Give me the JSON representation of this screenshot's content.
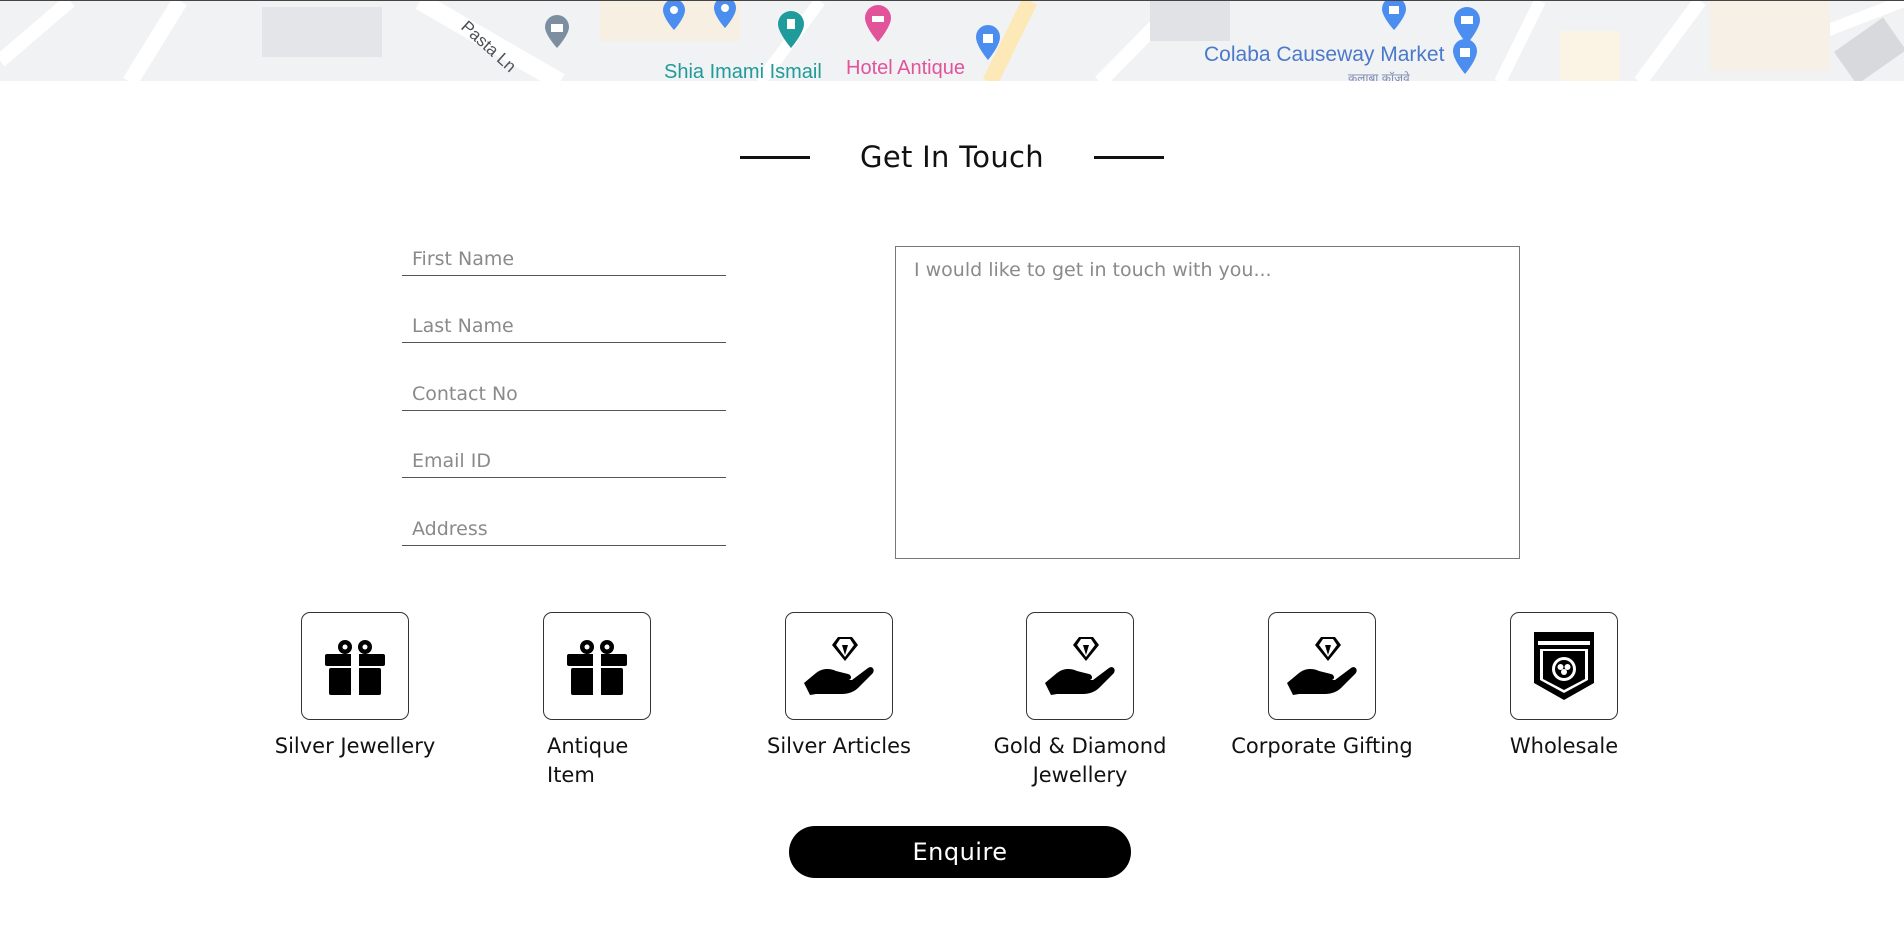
{
  "map": {
    "labels": {
      "street": "Pasta Ln",
      "shia": "Shia Imami Ismail",
      "hotel": "Hotel Antique",
      "colaba": "Colaba Causeway Market",
      "devnagari": "कुलाबा कॉजवे"
    },
    "colors": {
      "teal_pin": "#1e9b9a",
      "pink_pin": "#e1549a",
      "blue_pin": "#4b8ef0",
      "gray_pin": "#7c8ea0"
    }
  },
  "contact": {
    "heading": "Get In Touch",
    "fields": {
      "first_name": {
        "placeholder": "First Name",
        "value": ""
      },
      "last_name": {
        "placeholder": "Last Name",
        "value": ""
      },
      "contact_no": {
        "placeholder": "Contact No",
        "value": ""
      },
      "email_id": {
        "placeholder": "Email ID",
        "value": ""
      },
      "address": {
        "placeholder": "Address",
        "value": ""
      }
    },
    "message": {
      "placeholder": "I would like to get in touch with you...",
      "value": ""
    }
  },
  "categories": [
    {
      "label": "Silver Jewellery",
      "icon": "gift-icon"
    },
    {
      "label": "Antique Item",
      "icon": "gift-icon"
    },
    {
      "label": "Silver Articles",
      "icon": "diamond-hand-icon"
    },
    {
      "label": "Gold & Diamond Jewellery",
      "icon": "diamond-hand-icon"
    },
    {
      "label": "Corporate Gifting",
      "icon": "diamond-hand-icon"
    },
    {
      "label": "Wholesale",
      "icon": "badge-icon"
    }
  ],
  "actions": {
    "enquire_label": "Enquire"
  }
}
